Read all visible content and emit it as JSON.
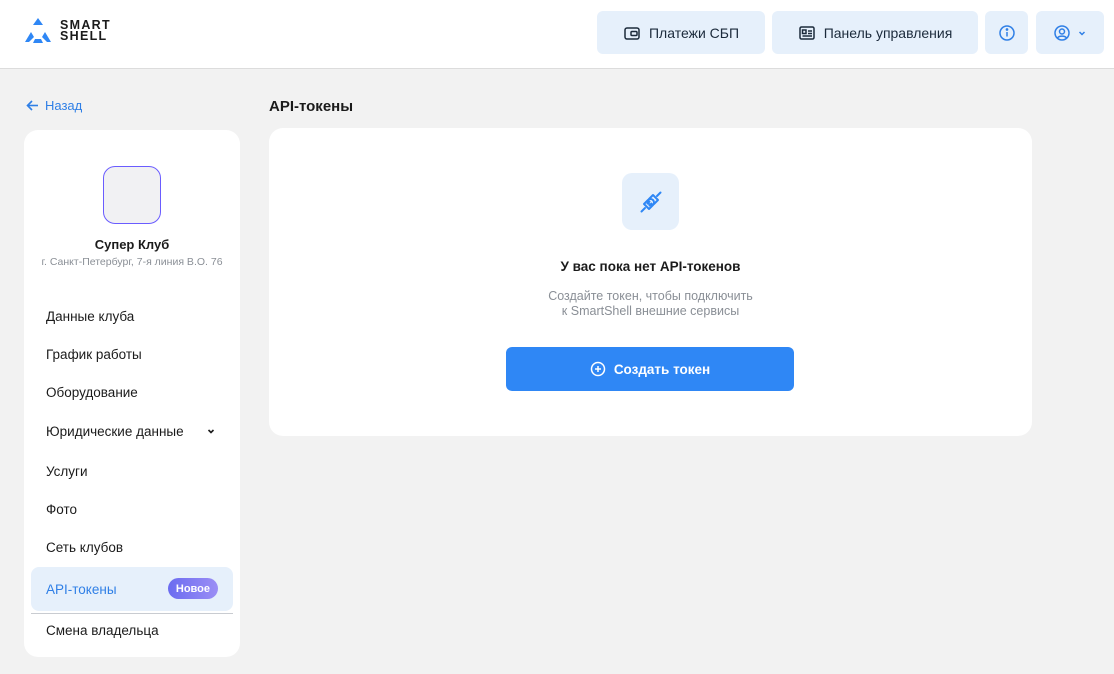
{
  "header": {
    "logo_line1": "SMART",
    "logo_line2": "SHELL",
    "sbp_label": "Платежи СБП",
    "panel_label": "Панель управления",
    "accent": "#2f7fe6"
  },
  "back_label": "Назад",
  "page_title": "API-токены",
  "club": {
    "name": "Супер Клуб",
    "address": "г. Санкт-Петербург, 7-я линия В.О. 76"
  },
  "menu": {
    "items": [
      {
        "label": "Данные клуба"
      },
      {
        "label": "График работы"
      },
      {
        "label": "Оборудование"
      },
      {
        "label": "Юридические данные",
        "icon": "chevron-down-icon"
      },
      {
        "label": "Услуги"
      },
      {
        "label": "Фото"
      },
      {
        "label": "Сеть клубов"
      },
      {
        "label": "API-токены",
        "active": true,
        "badge": "Новое"
      },
      {
        "label": "Смена владельца"
      }
    ]
  },
  "empty_state": {
    "icon": "plug-link-icon",
    "title": "У вас пока нет API-токенов",
    "subtitle_line1": "Создайте токен, чтобы подключить",
    "subtitle_line2": "к SmartShell внешние сервисы",
    "button_label": "Создать токен"
  }
}
